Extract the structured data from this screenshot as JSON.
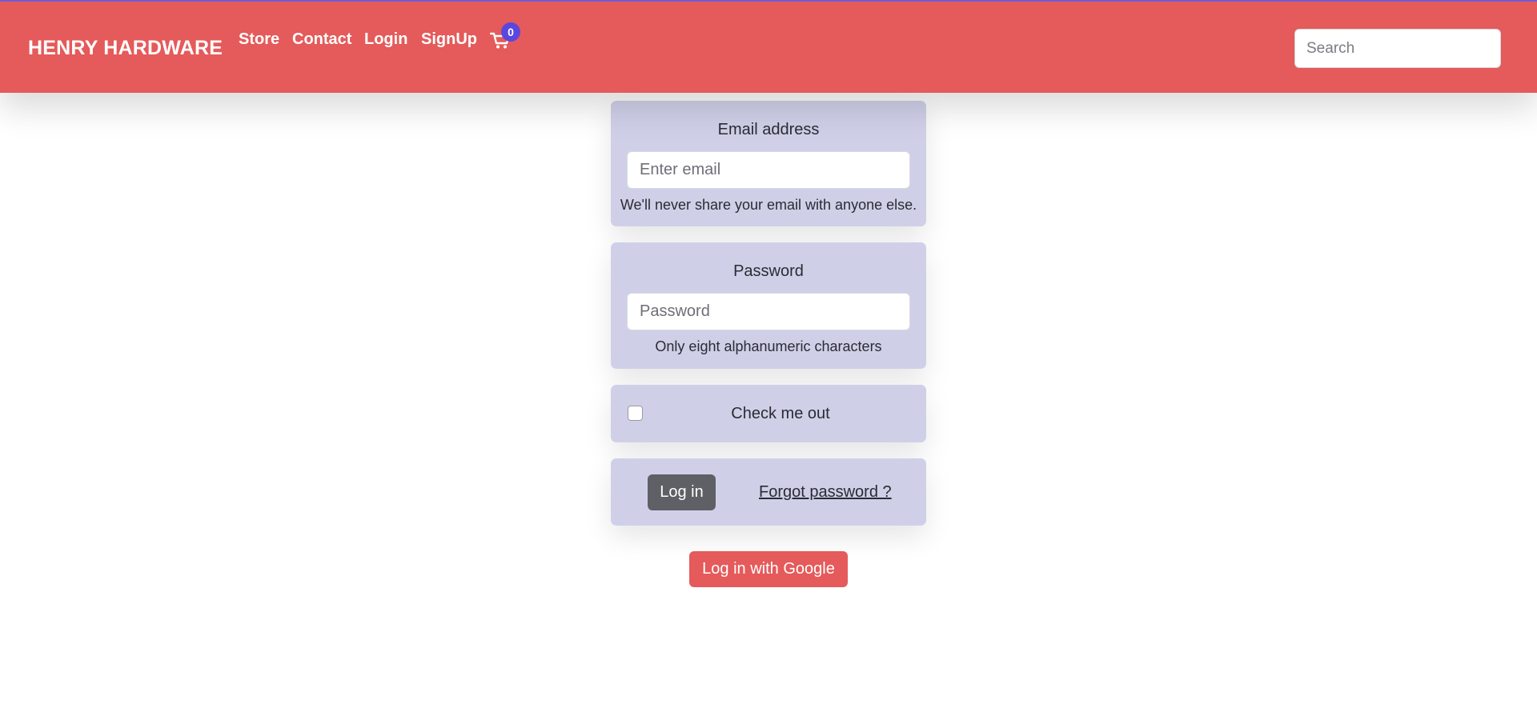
{
  "navbar": {
    "brand": "HENRY HARDWARE",
    "links": [
      {
        "label": "Store"
      },
      {
        "label": "Contact"
      },
      {
        "label": "Login"
      },
      {
        "label": "SignUp"
      }
    ],
    "cart": {
      "icon": "shopping-cart-icon",
      "count": "0"
    },
    "search": {
      "placeholder": "Search",
      "value": ""
    }
  },
  "login_form": {
    "email": {
      "label": "Email address",
      "placeholder": "Enter email",
      "value": "",
      "help": "We'll never share your email with anyone else."
    },
    "password": {
      "label": "Password",
      "placeholder": "Password",
      "value": "",
      "help": "Only eight alphanumeric characters"
    },
    "remember": {
      "label": "Check me out",
      "checked": false
    },
    "submit_label": "Log in",
    "forgot_label": "Forgot password ?",
    "google_label": "Log in with Google"
  },
  "colors": {
    "navbar": "#e55a5a",
    "card": "#cfd0e8",
    "badge": "#5a47de",
    "login_button": "#5f6066",
    "google_button": "#e55a5a"
  }
}
